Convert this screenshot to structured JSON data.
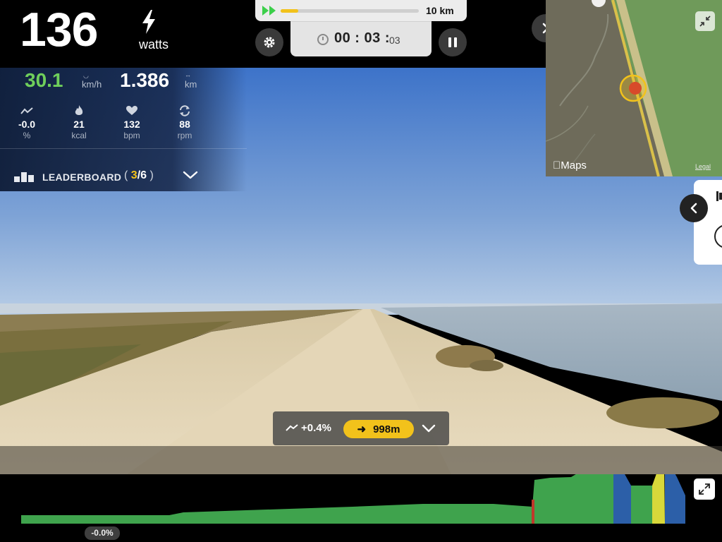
{
  "power": {
    "value": "136",
    "unit": "watts",
    "icon": "bolt-icon"
  },
  "progress": {
    "total_distance": "10 km",
    "progress_fraction": 0.13
  },
  "timer": {
    "main": "00 : 03 :",
    "fraction": "03"
  },
  "speed": {
    "value": "30.1",
    "unit": "km/h"
  },
  "distance": {
    "value": "1.386",
    "unit": "km"
  },
  "metrics": [
    {
      "icon": "gradient-icon",
      "value": "-0.0",
      "label": "%"
    },
    {
      "icon": "flame-icon",
      "value": "21",
      "label": "kcal"
    },
    {
      "icon": "heart-icon",
      "value": "132",
      "label": "bpm"
    },
    {
      "icon": "cadence-icon",
      "value": "88",
      "label": "rpm"
    }
  ],
  "leaderboard": {
    "label": "LEADERBOARD",
    "open": "(",
    "position": "3",
    "sep": "/",
    "total": "6",
    "close": ")"
  },
  "map": {
    "brand": "Maps",
    "legal": "Legal"
  },
  "slope": {
    "current": "+0.4%",
    "next_distance": "998m"
  },
  "elevation": {
    "current_grade": "-0.0%"
  },
  "colors": {
    "accent_yellow": "#f2c21b",
    "speed_green": "#6fcf5b",
    "panel_navy": "#0e1c37",
    "elev_green": "#3fa34d",
    "elev_blue": "#2c5fa8",
    "elev_yellow": "#d8d83a"
  }
}
